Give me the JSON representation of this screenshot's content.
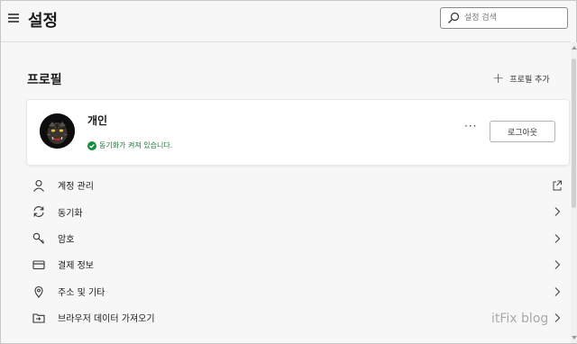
{
  "header": {
    "title": "설정",
    "menu_icon": "hamburger-icon"
  },
  "search": {
    "placeholder": "설정 검색",
    "icon": "search-icon"
  },
  "profile_section": {
    "title": "프로필",
    "add_profile_label": "프로필 추가",
    "add_icon": "plus-icon"
  },
  "profile_card": {
    "name": "개인",
    "sync_status": "동기화가 켜져 있습니다.",
    "sync_icon": "check-circle-icon",
    "more_label": "···",
    "logout_label": "로그아웃",
    "avatar": "tiger-avatar"
  },
  "menu": {
    "items": [
      {
        "label": "계정 관리",
        "icon": "person-icon",
        "trailing": "external-link-icon"
      },
      {
        "label": "동기화",
        "icon": "sync-icon",
        "trailing": "chevron-right-icon"
      },
      {
        "label": "암호",
        "icon": "key-icon",
        "trailing": "chevron-right-icon"
      },
      {
        "label": "결제 정보",
        "icon": "credit-card-icon",
        "trailing": "chevron-right-icon"
      },
      {
        "label": "주소 및 기타",
        "icon": "location-pin-icon",
        "trailing": "chevron-right-icon"
      },
      {
        "label": "브라우저 데이터 가져오기",
        "icon": "import-folder-icon",
        "trailing": "chevron-right-icon"
      }
    ]
  },
  "watermark": "itFix blog",
  "colors": {
    "background": "#f7f7f7",
    "card": "#ffffff",
    "sync_green": "#1a7a36",
    "text": "#1b1b1b"
  }
}
